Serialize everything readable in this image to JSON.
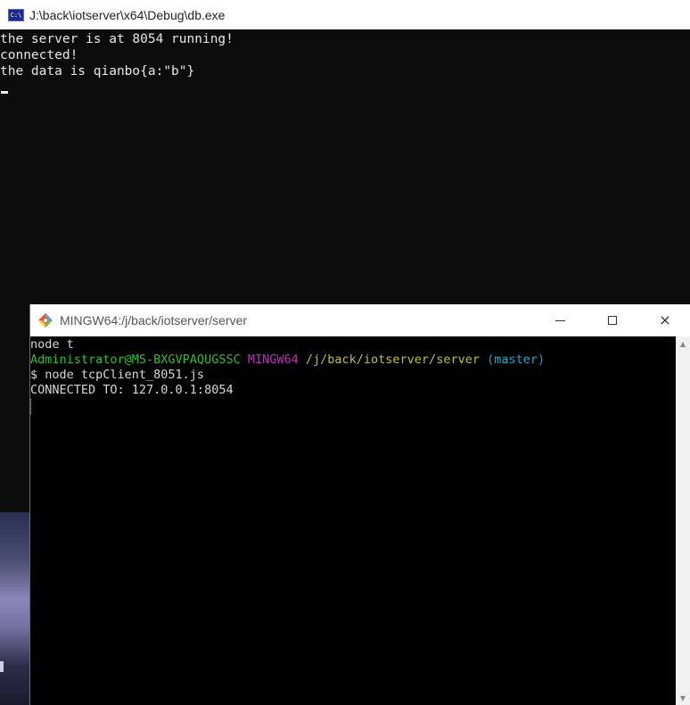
{
  "cmd_window": {
    "icon": "cmd-icon",
    "icon_text": "C:\\",
    "title": "J:\\back\\iotserver\\x64\\Debug\\db.exe",
    "lines": [
      "the server is at 8054 running!",
      "connected!",
      "the data is qianbo{a:\"b\"}"
    ]
  },
  "mingw_window": {
    "icon": "git-bash-icon",
    "title": "MINGW64:/j/back/iotserver/server",
    "controls": {
      "minimize": "minimize-icon",
      "maximize": "maximize-icon",
      "close": "×"
    },
    "terminal": {
      "line1": "node t",
      "prompt": {
        "user_host": "Administrator@MS-BXGVPAQUGSSC",
        "env": "MINGW64",
        "path": "/j/back/iotserver/server",
        "branch": "(master)"
      },
      "command": "$ node tcpClient_8051.js",
      "output": "CONNECTED TO: 127.0.0.1:8054"
    }
  },
  "colors": {
    "cmd_bg": "#0c0c0c",
    "terminal_bg": "#000000",
    "prompt_green": "#2fbf2f",
    "prompt_magenta": "#c030c0",
    "prompt_yellow": "#c0c030",
    "prompt_cyan": "#20a8c8"
  }
}
